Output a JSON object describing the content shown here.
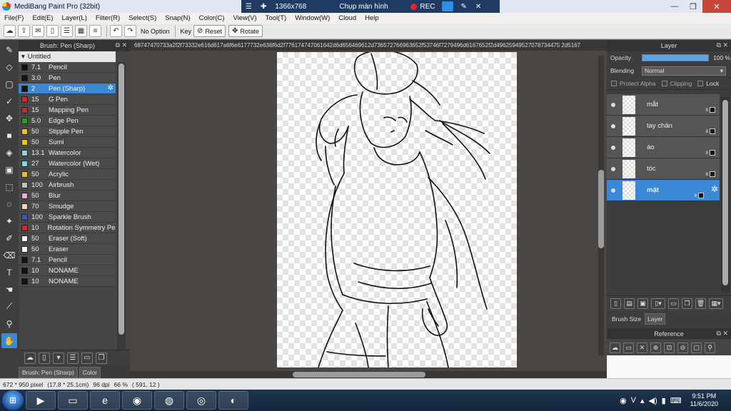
{
  "window": {
    "title": "MediBang Paint Pro (32bit)",
    "recorder": {
      "resolution": "1366x768",
      "capture_label": "Chụp màn hình",
      "rec_label": "REC"
    },
    "controls": {
      "minimize": "—",
      "restore": "❐",
      "close": "✕"
    }
  },
  "menu": [
    "File(F)",
    "Edit(E)",
    "Layer(L)",
    "Filter(R)",
    "Select(S)",
    "Snap(N)",
    "Color(C)",
    "View(V)",
    "Tool(T)",
    "Window(W)",
    "Cloud",
    "Help"
  ],
  "toolbar": {
    "option_label": "No Option",
    "key_label": "Key",
    "reset_label": "Reset",
    "rotate_label": "Rotate"
  },
  "brush_panel": {
    "title": "Brush: Pen (Sharp)",
    "group": "Untitled",
    "selected_index": 2,
    "items": [
      {
        "size": "7.1",
        "name": "Pencil",
        "color": "#111111"
      },
      {
        "size": "3.0",
        "name": "Pen",
        "color": "#111111"
      },
      {
        "size": "2",
        "name": "Pen (Sharp)",
        "color": "#111111"
      },
      {
        "size": "15",
        "name": "G Pen",
        "color": "#e02020"
      },
      {
        "size": "15",
        "name": "Mapping Pen",
        "color": "#e02020"
      },
      {
        "size": "5.0",
        "name": "Edge Pen",
        "color": "#21a321"
      },
      {
        "size": "50",
        "name": "Stipple Pen",
        "color": "#f2c200"
      },
      {
        "size": "50",
        "name": "Sumi",
        "color": "#f2c200"
      },
      {
        "size": "13.1",
        "name": "Watercolor",
        "color": "#7fd6f2"
      },
      {
        "size": "27",
        "name": "Watercolor (Wet)",
        "color": "#7fd6f2"
      },
      {
        "size": "50",
        "name": "Acrylic",
        "color": "#f2c200"
      },
      {
        "size": "100",
        "name": "Airbrush",
        "color": "#c0c0c0"
      },
      {
        "size": "50",
        "name": "Blur",
        "color": "#f2a6d6"
      },
      {
        "size": "70",
        "name": "Smudge",
        "color": "#f7d4b0"
      },
      {
        "size": "100",
        "name": "Sparkle Brush",
        "color": "#3355dd"
      },
      {
        "size": "10",
        "name": "Rotation Symmetry Pen",
        "color": "#e02020"
      },
      {
        "size": "50",
        "name": "Eraser (Soft)",
        "color": "#ffffff"
      },
      {
        "size": "50",
        "name": "Eraser",
        "color": "#ffffff"
      },
      {
        "size": "7.1",
        "name": "Pencil",
        "color": "#111111"
      },
      {
        "size": "10",
        "name": "NONAME",
        "color": "#111111"
      },
      {
        "size": "10",
        "name": "NONAME",
        "color": "#111111"
      }
    ],
    "tabs": [
      "Brush: Pen (Sharp)",
      "Color"
    ]
  },
  "canvas": {
    "tab_text": "68747470733a2f2f73332e616d617a6f6e6177732e636f6d2f776174747061642d6d656469612d736572766963652f53746f7279496d6167652f2d49625949527078734475 2d5167"
  },
  "layer_panel": {
    "title": "Layer",
    "opacity_label": "Opacity",
    "opacity_value": "100 %",
    "opacity_fraction": 1.0,
    "blending_label": "Blending",
    "blending_value": "Normal",
    "protect_alpha": "Protect Alpha",
    "clipping": "Clipping",
    "lock": "Lock",
    "selected_index": 4,
    "layers": [
      {
        "name": "mắt",
        "bits": "8"
      },
      {
        "name": "tay chân",
        "bits": "8"
      },
      {
        "name": "áo",
        "bits": "8"
      },
      {
        "name": "tóc",
        "bits": "8"
      },
      {
        "name": "mặt",
        "bits": "8"
      }
    ],
    "tabs": [
      "Brush Size",
      "Layer"
    ]
  },
  "reference_panel": {
    "title": "Reference"
  },
  "status": {
    "size": "672 * 950 pixel",
    "physical": "(17.8 * 25.1cm)",
    "dpi": "96 dpi",
    "zoom": "66 %",
    "cursor": "( 591, 12 )"
  },
  "taskbar": {
    "time": "9:51 PM",
    "date": "11/6/2020"
  },
  "colors": {
    "accent": "#3b89d6",
    "panel_dark": "#3d3d3d",
    "canvas_bg": "#4a4643"
  }
}
